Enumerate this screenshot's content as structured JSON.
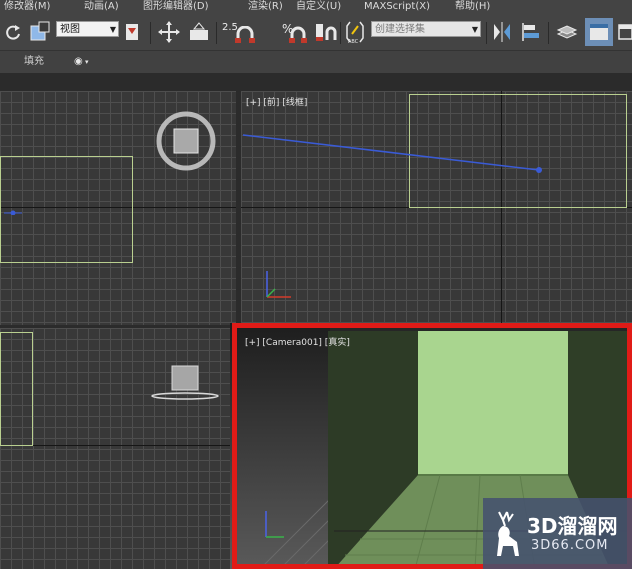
{
  "menu": {
    "items": [
      "修改器(M)",
      "动画(A)",
      "图形编辑器(D)",
      "渲染(R)",
      "自定义(U)",
      "MAXScript(X)",
      "帮助(H)"
    ]
  },
  "toolbar": {
    "view_dropdown": "视图",
    "snap_value": "2.5",
    "percent_symbol": "%",
    "selection_set_placeholder": "创建选择集"
  },
  "ribbon": {
    "fill_label": "填充"
  },
  "viewports": {
    "top_right_label": "[+] [前] [线框]",
    "bottom_right_label": "[+] [Camera001] [真实]"
  },
  "watermark": {
    "brand": "3D溜溜网",
    "domain": "3D66.COM"
  },
  "colors": {
    "highlight_border": "#e01b17",
    "object_outline": "#b9cf8f",
    "camera_room_wall": "#a9d58f",
    "camera_side_wall": "#2d3b26"
  }
}
